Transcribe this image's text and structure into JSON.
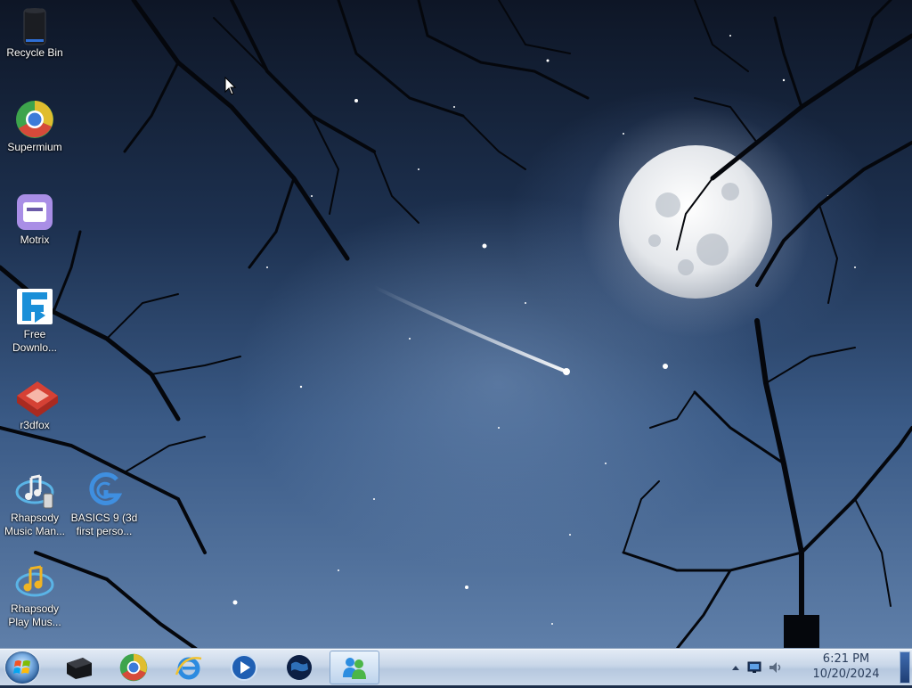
{
  "desktop": {
    "icons": [
      {
        "id": "recycle-bin",
        "label": "Recycle Bin",
        "icon": "recycle-bin-icon"
      },
      {
        "id": "supermium",
        "label": "Supermium",
        "icon": "supermium-browser-icon"
      },
      {
        "id": "motrix",
        "label": "Motrix",
        "icon": "motrix-icon"
      },
      {
        "id": "free-download",
        "label": "Free Downlo...",
        "icon": "free-download-manager-icon"
      },
      {
        "id": "r3dfox",
        "label": "r3dfox",
        "icon": "r3dfox-icon"
      },
      {
        "id": "rhapsody-music-manager",
        "label": "Rhapsody Music Man...",
        "icon": "rhapsody-music-manager-icon"
      },
      {
        "id": "basics9",
        "label": "BASICS 9 (3d first perso...",
        "icon": "basics9-icon"
      },
      {
        "id": "rhapsody-play-music",
        "label": "Rhapsody Play Mus...",
        "icon": "rhapsody-play-music-icon"
      }
    ]
  },
  "taskbar": {
    "start_icon": "windows-start-orb-icon",
    "pinned": [
      {
        "name": "media-center",
        "icon": "black-box-icon"
      },
      {
        "name": "supermium",
        "icon": "supermium-browser-icon"
      },
      {
        "name": "internet-explorer",
        "icon": "internet-explorer-icon"
      },
      {
        "name": "media-player",
        "icon": "media-player-icon"
      },
      {
        "name": "globe-app",
        "icon": "globe-icon"
      },
      {
        "name": "messenger",
        "icon": "messenger-people-icon",
        "active": true
      }
    ],
    "tray": {
      "overflow_icon": "chevron-up-icon",
      "network_icon": "network-monitor-icon",
      "volume_icon": "speaker-icon"
    },
    "clock": {
      "time": "6:21 PM",
      "date": "10/20/2024"
    }
  }
}
